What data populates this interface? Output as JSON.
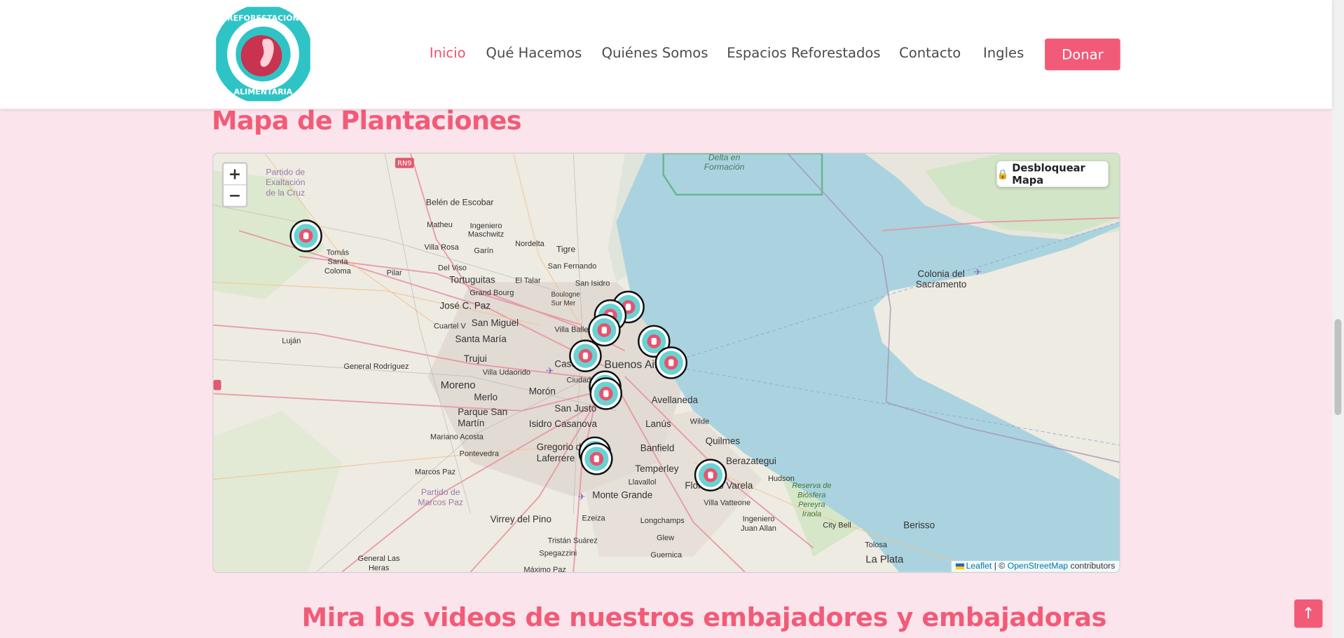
{
  "header": {
    "logo_text": "REFORESTACIÓN ALIMENTARIA",
    "nav": [
      {
        "label": "Inicio",
        "active": true
      },
      {
        "label": "Qué Hacemos"
      },
      {
        "label": "Quiénes Somos"
      },
      {
        "label": "Espacios Reforestados"
      },
      {
        "label": "Contacto"
      },
      {
        "label": "Ingles"
      }
    ],
    "donate_label": "Donar"
  },
  "map_section": {
    "title": "Mapa de Plantaciones",
    "zoom_in": "+",
    "zoom_out": "−",
    "unlock_label": "Desbloquear Mapa",
    "unlock_icon": "lock-icon",
    "attribution": {
      "leaflet": "Leaflet",
      "sep": " | © ",
      "osm": "OpenStreetMap",
      "suffix": " contributors"
    },
    "marker_count": 12,
    "place_labels": [
      "Partido de Exaltación de la Cruz",
      "Belén de Escobar",
      "Matheu",
      "Ingeniero Maschwitz",
      "Garín",
      "Nordelta",
      "Tigre",
      "Villa Rosa",
      "Tomás Santa Coloma",
      "Pilar",
      "Del Viso",
      "Tortuguitas",
      "El Talar",
      "San Fernando",
      "San Isidro",
      "Grand Bourg",
      "Boulogne Sur Mer",
      "José C. Paz",
      "San Miguel",
      "Cuartel V",
      "Villa Ballester",
      "Santa María",
      "Luján",
      "General Rodríguez",
      "Trujui",
      "Villa Udaondo",
      "Caseros",
      "Buenos Aires",
      "Ciudadela",
      "Moreno",
      "Merlo",
      "Morón",
      "San Justo",
      "Avellaneda",
      "Parque San Martín",
      "Isidro Casanova",
      "Lanús",
      "Wilde",
      "Mariano Acosta",
      "Pontevedra",
      "Gregorio de Laferrere",
      "Banfield",
      "Quilmes",
      "Berazategui",
      "Temperley",
      "Llavallol",
      "Marcos Paz",
      "Partido de Marcos Paz",
      "Monte Grande",
      "Florencio Varela",
      "Hudson",
      "Reserva de Biósfera Pereyra Iraola",
      "Villa Vatteone",
      "Virrey del Pino",
      "Ezeiza",
      "Longchamps",
      "Ingeniero Juan Allan",
      "City Bell",
      "Berisso",
      "Tristán Suárez",
      "Glew",
      "Guernica",
      "Spegazzini",
      "Tolosa",
      "La Plata",
      "General Las Heras",
      "Máximo Paz",
      "Delta en Formación",
      "Colonia del Sacramento",
      "RN9"
    ]
  },
  "videos_section": {
    "title": "Mira los videos de nuestros embajadores y embajadoras"
  },
  "colors": {
    "accent": "#f25b77",
    "water": "#aad3df",
    "land": "#f2efe9",
    "page_bg": "#fce4ec",
    "marker_teal": "#6ad3d2"
  }
}
